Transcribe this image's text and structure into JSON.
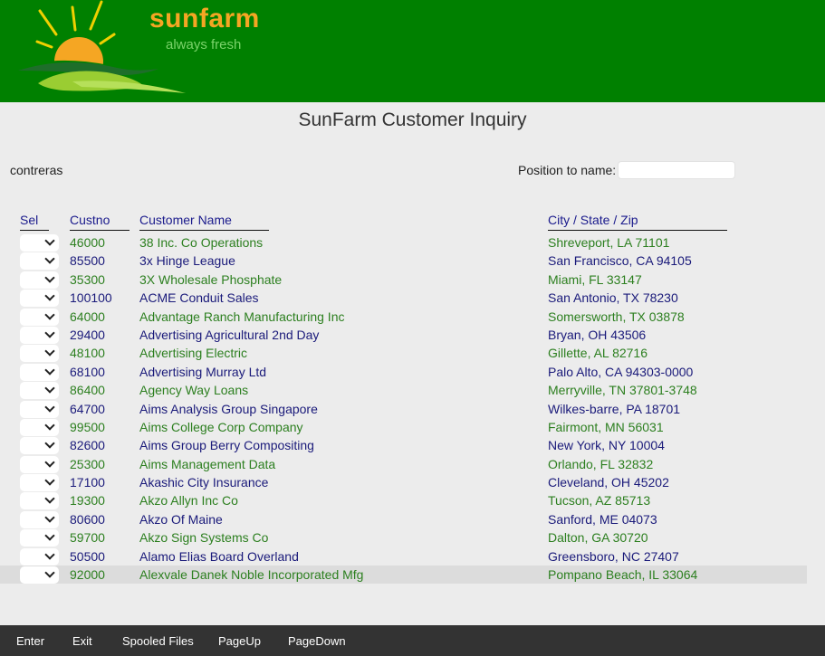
{
  "brand": {
    "name": "sunfarm",
    "tagline": "always fresh"
  },
  "page": {
    "title": "SunFarm Customer Inquiry"
  },
  "user": "contreras",
  "position": {
    "label": "Position to name:",
    "value": ""
  },
  "columns": {
    "sel": "Sel",
    "custno": "Custno",
    "name": "Customer Name",
    "city": "City / State / Zip"
  },
  "rows": [
    {
      "custno": "46000",
      "name": "38 Inc. Co Operations",
      "city": "Shreveport, LA 71101"
    },
    {
      "custno": "85500",
      "name": "3x Hinge League",
      "city": "San Francisco, CA 94105"
    },
    {
      "custno": "35300",
      "name": "3X Wholesale Phosphate",
      "city": "Miami, FL 33147"
    },
    {
      "custno": "100100",
      "name": "ACME Conduit Sales",
      "city": "San Antonio, TX 78230"
    },
    {
      "custno": "64000",
      "name": "Advantage Ranch Manufacturing Inc",
      "city": "Somersworth, TX 03878"
    },
    {
      "custno": "29400",
      "name": "Advertising Agricultural 2nd Day",
      "city": "Bryan, OH 43506"
    },
    {
      "custno": "48100",
      "name": "Advertising Electric",
      "city": "Gillette, AL 82716"
    },
    {
      "custno": "68100",
      "name": "Advertising Murray Ltd",
      "city": "Palo Alto, CA 94303-0000"
    },
    {
      "custno": "86400",
      "name": "Agency Way Loans",
      "city": "Merryville, TN 37801-3748"
    },
    {
      "custno": "64700",
      "name": "Aims Analysis Group Singapore",
      "city": "Wilkes-barre, PA 18701"
    },
    {
      "custno": "99500",
      "name": "Aims College Corp Company",
      "city": "Fairmont, MN 56031"
    },
    {
      "custno": "82600",
      "name": "Aims Group Berry Compositing",
      "city": "New York, NY 10004"
    },
    {
      "custno": "25300",
      "name": "Aims Management Data",
      "city": "Orlando, FL 32832"
    },
    {
      "custno": "17100",
      "name": "Akashic City Insurance",
      "city": "Cleveland, OH 45202"
    },
    {
      "custno": "19300",
      "name": "Akzo Allyn Inc Co",
      "city": "Tucson, AZ 85713"
    },
    {
      "custno": "80600",
      "name": "Akzo Of Maine",
      "city": "Sanford, ME 04073"
    },
    {
      "custno": "59700",
      "name": "Akzo Sign Systems Co",
      "city": "Dalton, GA 30720"
    },
    {
      "custno": "50500",
      "name": "Alamo Elias Board Overland",
      "city": "Greensboro, NC 27407"
    },
    {
      "custno": "92000",
      "name": "Alexvale Danek Noble Incorporated Mfg",
      "city": "Pompano Beach, IL 33064"
    }
  ],
  "footer": {
    "enter": "Enter",
    "exit": "Exit",
    "spooled": "Spooled Files",
    "pageup": "PageUp",
    "pagedown": "PageDown"
  },
  "colors": {
    "header_bg": "#008000",
    "brand": "#f5a623",
    "tagline": "#7bd36a",
    "row_green": "#2c7f1f",
    "row_blue": "#1a1a7a",
    "footer_bg": "#333333"
  }
}
